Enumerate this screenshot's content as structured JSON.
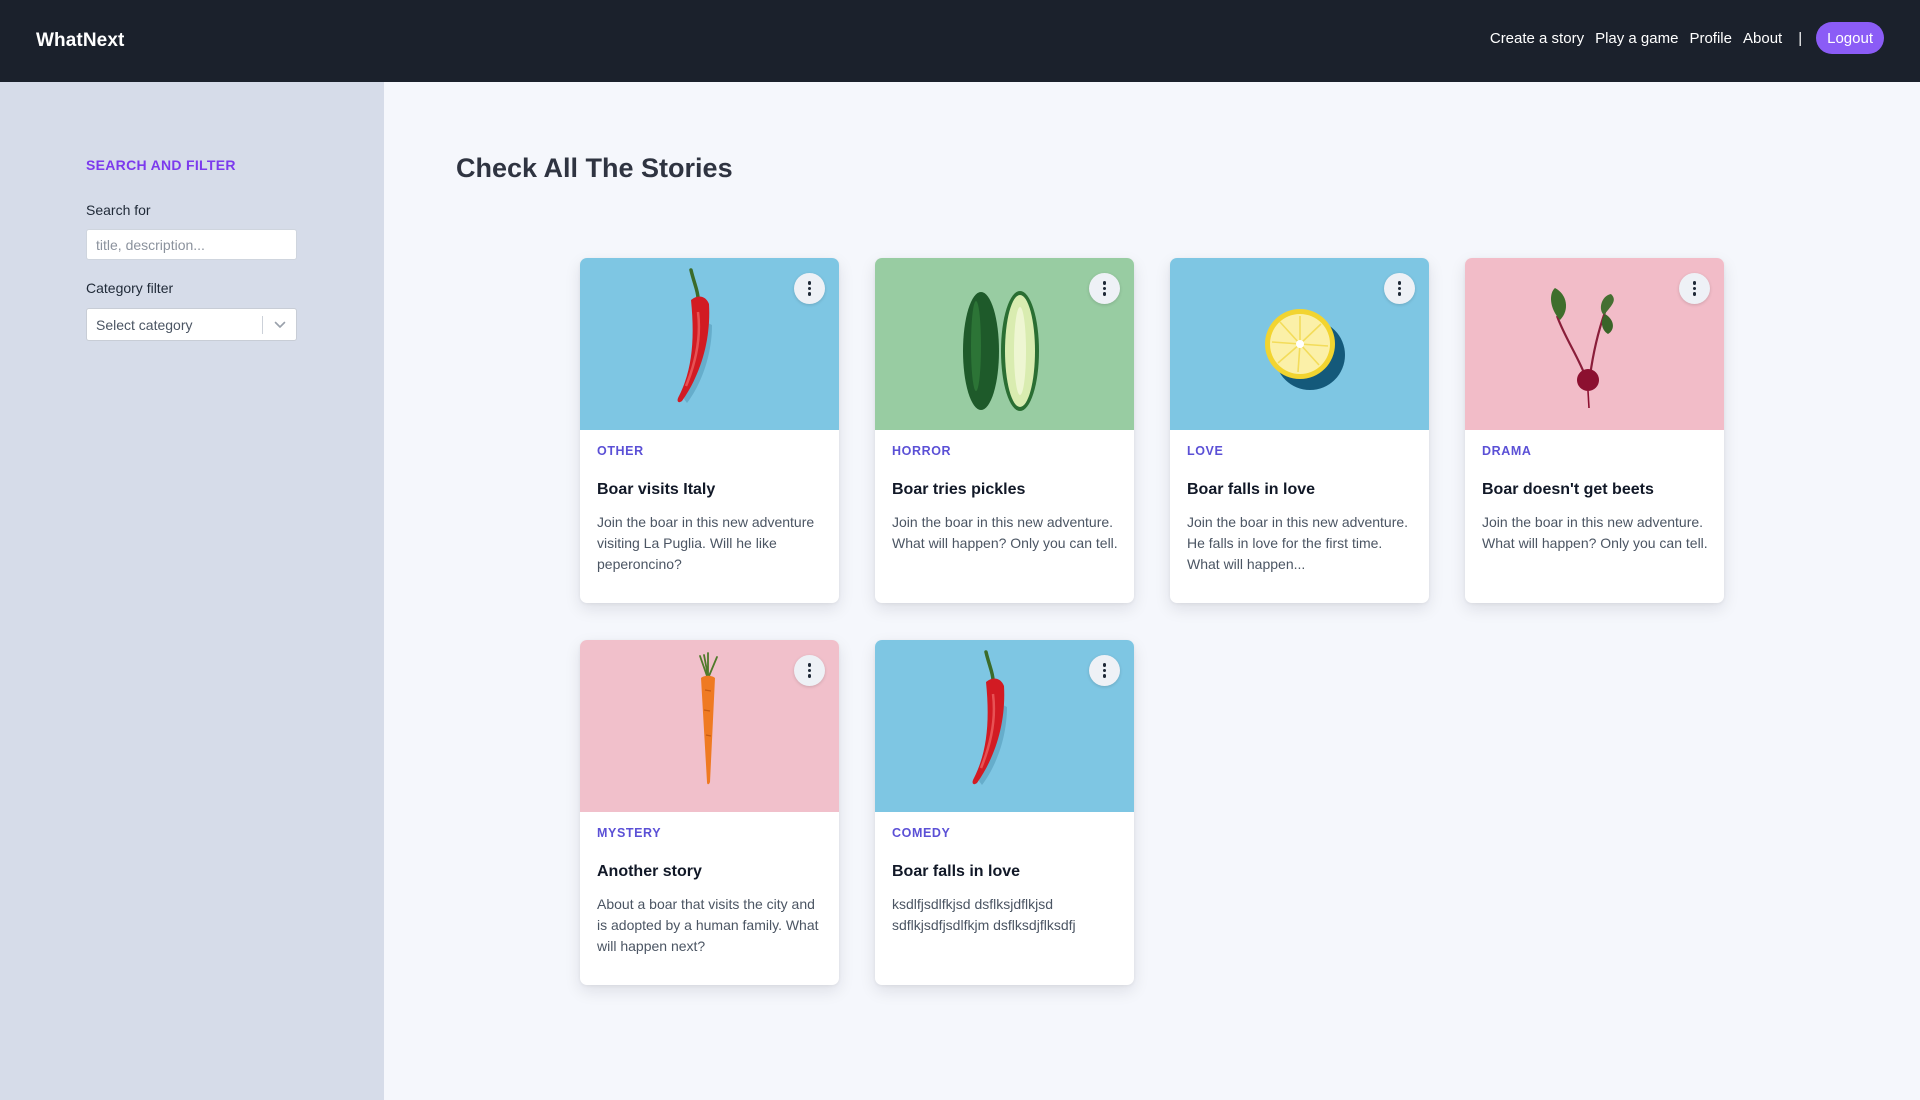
{
  "nav": {
    "brand": "WhatNext",
    "links": [
      "Create a story",
      "Play a game",
      "Profile",
      "About"
    ],
    "separator": "|",
    "logout_label": "Logout"
  },
  "sidebar": {
    "title": "SEARCH AND FILTER",
    "search_label": "Search for",
    "search_placeholder": "title, description...",
    "search_value": "",
    "category_label": "Category filter",
    "category_value": "Select category"
  },
  "main": {
    "title": "Check All The Stories",
    "cards": [
      {
        "category": "OTHER",
        "title": "Boar visits Italy",
        "description": "Join the boar in this new adventure visiting La Puglia. Will he like peperoncino?",
        "image": "chili-pepper-image",
        "image_bg": "#7ec6e3"
      },
      {
        "category": "HORROR",
        "title": "Boar tries pickles",
        "description": "Join the boar in this new adventure. What will happen? Only you can tell.",
        "image": "cucumber-image",
        "image_bg": "#98cca2"
      },
      {
        "category": "LOVE",
        "title": "Boar falls in love",
        "description": "Join the boar in this new adventure. He falls in love for the first time. What will happen...",
        "image": "lemon-image",
        "image_bg": "#7ec6e3"
      },
      {
        "category": "DRAMA",
        "title": "Boar doesn't get beets",
        "description": "Join the boar in this new adventure. What will happen? Only you can tell.",
        "image": "beet-image",
        "image_bg": "#f2bcc8"
      },
      {
        "category": "MYSTERY",
        "title": "Another story",
        "description": "About a boar that visits the city and is adopted by a human family. What will happen next?",
        "image": "carrot-image",
        "image_bg": "#f1c0cb"
      },
      {
        "category": "COMEDY",
        "title": "Boar falls in love",
        "description": "ksdlfjsdlfkjsd dsflksjdflkjsd sdflkjsdfjsdlfkjm dsflksdjflksdfj",
        "image": "chili-pepper-image",
        "image_bg": "#7ec6e3"
      }
    ]
  },
  "colors": {
    "nav_bg": "#1b212c",
    "sidebar_bg": "#d6dce9",
    "page_bg": "#f5f7fc",
    "accent_purple": "#8b5cf6",
    "sidebar_title": "#7c3aed",
    "category_text": "#5b50d6"
  }
}
